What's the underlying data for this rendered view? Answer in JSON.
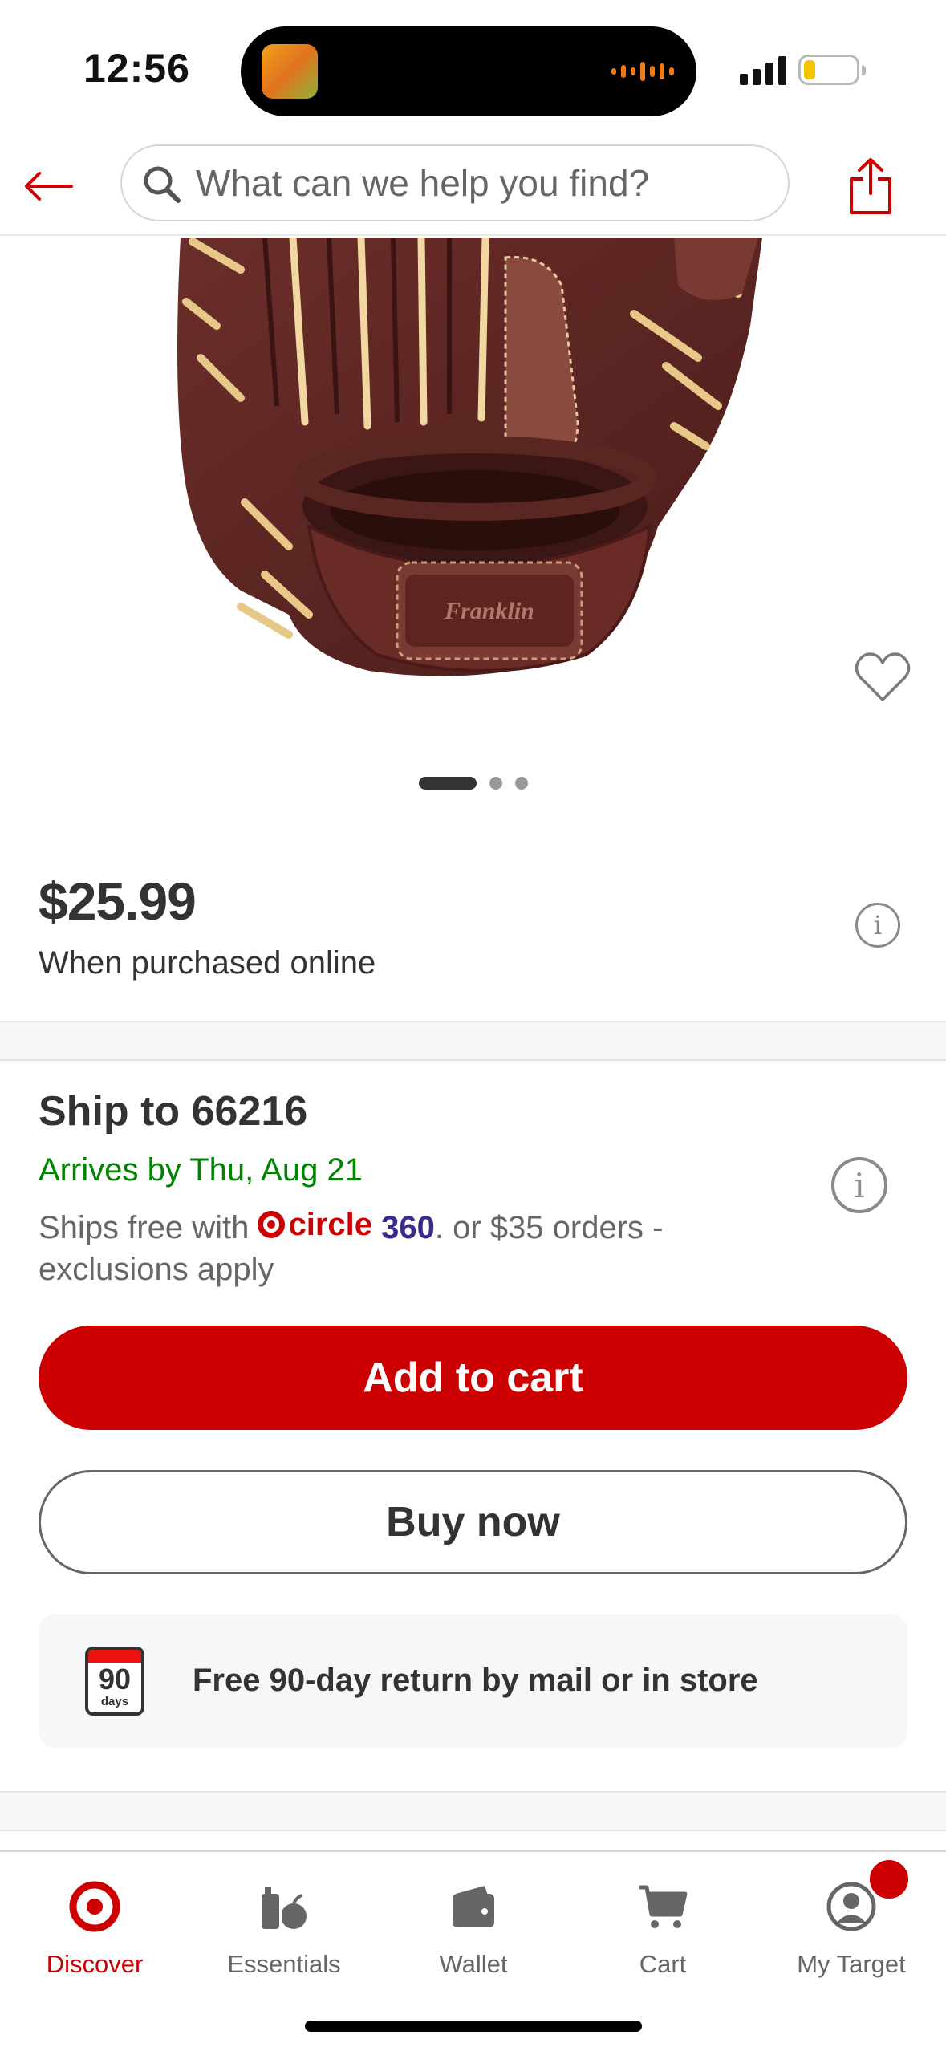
{
  "status_bar": {
    "time": "12:56"
  },
  "header": {
    "search_placeholder": "What can we help you find?"
  },
  "carousel": {
    "total_images": 3,
    "active_index": 0
  },
  "price": {
    "amount": "$25.99",
    "subtitle": "When purchased online"
  },
  "shipping": {
    "title": "Ship to 66216",
    "arrives": "Arrives by Thu, Aug 21",
    "ships_free_prefix": "Ships free with ",
    "circle_word": "circle",
    "circle_360": "360",
    "ships_free_suffix": ". or $35 orders - exclusions apply"
  },
  "actions": {
    "add_to_cart": "Add to cart",
    "buy_now": "Buy now"
  },
  "returns": {
    "calendar_number": "90",
    "calendar_unit": "days",
    "text": "Free 90-day return by mail or in store"
  },
  "tab_bar": {
    "tabs": [
      {
        "label": "Discover",
        "icon": "target-bullseye-icon",
        "active": true
      },
      {
        "label": "Essentials",
        "icon": "essentials-icon",
        "active": false
      },
      {
        "label": "Wallet",
        "icon": "wallet-icon",
        "active": false
      },
      {
        "label": "Cart",
        "icon": "cart-icon",
        "active": false
      },
      {
        "label": "My Target",
        "icon": "profile-icon",
        "active": false
      }
    ]
  },
  "colors": {
    "brand_red": "#cc0000",
    "arrival_green": "#008300",
    "circle360_purple": "#3a2c8c"
  }
}
